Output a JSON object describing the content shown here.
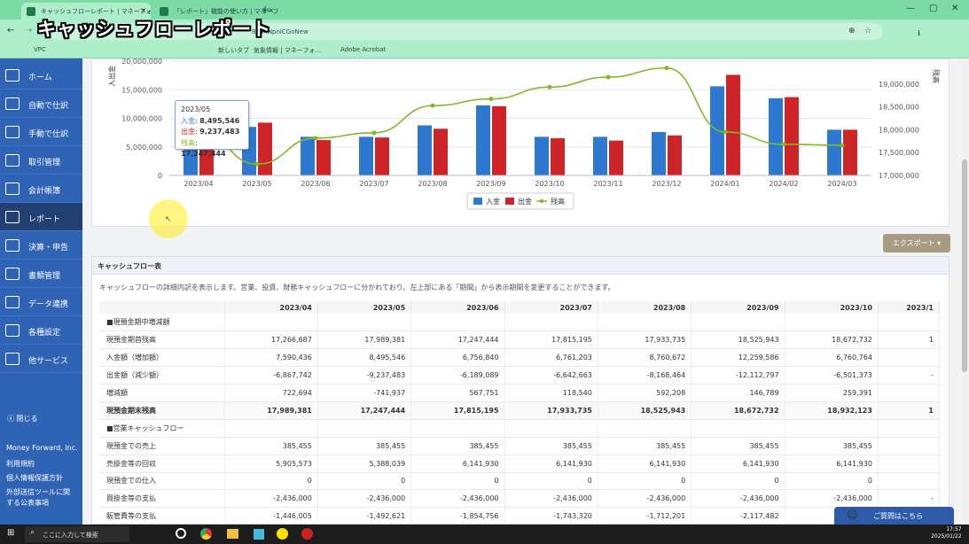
{
  "overlay_title": "キャッシュフローレポート",
  "browser": {
    "tabs": [
      {
        "label": "キャッシュフローレポート | マネーフォワ"
      },
      {
        "label": "「レポート」機能の使い方 | マネーフォ"
      }
    ],
    "url": "8644NpnlCGoNew",
    "bookmarks": [
      "VPC",
      "新しいタブ",
      "気象情報 | マネーフォ...",
      "Adobe Acrobat"
    ]
  },
  "sidebar": {
    "items": [
      {
        "label": "ホーム",
        "icon": "home-icon"
      },
      {
        "label": "自動で仕訳",
        "icon": "auto-journal-icon"
      },
      {
        "label": "手動で仕訳",
        "icon": "manual-journal-icon"
      },
      {
        "label": "取引管理",
        "icon": "transaction-icon"
      },
      {
        "label": "会計帳簿",
        "icon": "ledger-icon"
      },
      {
        "label": "レポート",
        "icon": "report-icon"
      },
      {
        "label": "決算・申告",
        "icon": "settlement-icon"
      },
      {
        "label": "書類管理",
        "icon": "folder-icon"
      },
      {
        "label": "データ連携",
        "icon": "link-icon"
      },
      {
        "label": "各種設定",
        "icon": "gear-icon"
      },
      {
        "label": "他サービス",
        "icon": "list-icon"
      }
    ],
    "close_label": "閉じる",
    "footer": [
      "Money Forward, Inc.",
      "利用規約",
      "個人情報保護方針",
      "外部送信ツールに関",
      "する公表事項"
    ]
  },
  "chart_data": {
    "type": "bar",
    "categories": [
      "2023/04",
      "2023/05",
      "2023/06",
      "2023/07",
      "2023/08",
      "2023/09",
      "2023/10",
      "2023/11",
      "2023/12",
      "2024/01",
      "2024/02",
      "2024/03"
    ],
    "series": [
      {
        "name": "入金",
        "color": "#2f78d0",
        "values": [
          7590436,
          8495546,
          6756840,
          6761203,
          8760672,
          12259586,
          6760764,
          6760764,
          7600000,
          15600000,
          13500000,
          8000000
        ]
      },
      {
        "name": "出金",
        "color": "#cc2428",
        "values": [
          8367742,
          9237483,
          6189089,
          6642663,
          8168464,
          12112797,
          6501373,
          6100000,
          7000000,
          17600000,
          13700000,
          8000000
        ]
      },
      {
        "name": "残高",
        "color": "#86b62a",
        "axis": "right",
        "values": [
          17989381,
          17247444,
          17815195,
          17933735,
          18525943,
          18672732,
          18932123,
          19150000,
          19350000,
          17950000,
          17680000,
          17660000
        ]
      }
    ],
    "ylabel": "入出金",
    "y2label": "残高",
    "ylim": [
      0,
      20000000
    ],
    "y2lim": [
      17000000,
      19500000
    ],
    "yticks": [
      "0",
      "5,000,000",
      "10,000,000",
      "15,000,000",
      "20,000,000"
    ],
    "y2ticks": [
      "17,000,000",
      "17,500,000",
      "18,000,000",
      "18,500,000",
      "19,000,000"
    ],
    "legend": [
      "入金",
      "出金",
      "残高"
    ],
    "legend_position": "bottom",
    "tooltip": {
      "title": "2023/05",
      "in_label": "入金",
      "in_value": "8,495,546",
      "out_label": "出金",
      "out_value": "9,237,483",
      "bal_label": "残高",
      "bal_value": "17,247,444"
    }
  },
  "export_label": "エクスポート ▾",
  "cashflow": {
    "title": "キャッシュフロー表",
    "description": "キャッシュフローの詳細内訳を表示します。営業、投資、財務キャッシュフローに分かれており、左上部にある「期間」から表示期間を変更することができます。",
    "headers": [
      "",
      "2023/04",
      "2023/05",
      "2023/06",
      "2023/07",
      "2023/08",
      "2023/09",
      "2023/10",
      "2023/1"
    ],
    "rows": [
      {
        "label": "■現預金期中増減額",
        "cells": [
          "",
          "",
          "",
          "",
          "",
          "",
          "",
          ""
        ]
      },
      {
        "label": "現預金期首残高",
        "cells": [
          "17,266,687",
          "17,989,381",
          "17,247,444",
          "17,815,195",
          "17,933,735",
          "18,525,943",
          "18,672,732",
          "1"
        ]
      },
      {
        "label": "入金額（増加額）",
        "cells": [
          "7,590,436",
          "8,495,546",
          "6,756,840",
          "6,761,203",
          "8,760,672",
          "12,259,586",
          "6,760,764",
          ""
        ]
      },
      {
        "label": "出金額（減少額）",
        "cells": [
          "-6,867,742",
          "-9,237,483",
          "-6,189,089",
          "-6,642,663",
          "-8,168,464",
          "-12,112,797",
          "-6,501,373",
          "-"
        ]
      },
      {
        "label": "増減額",
        "cells": [
          "722,694",
          "-741,937",
          "567,751",
          "118,540",
          "592,208",
          "146,789",
          "259,391",
          ""
        ]
      },
      {
        "label": "現預金期末残高",
        "total": true,
        "cells": [
          "17,989,381",
          "17,247,444",
          "17,815,195",
          "17,933,735",
          "18,525,943",
          "18,672,732",
          "18,932,123",
          "1"
        ]
      },
      {
        "label": "■営業キャッシュフロー",
        "cells": [
          "",
          "",
          "",
          "",
          "",
          "",
          "",
          ""
        ]
      },
      {
        "label": "現預金での売上",
        "cells": [
          "385,455",
          "385,455",
          "385,455",
          "385,455",
          "385,455",
          "385,455",
          "385,455",
          ""
        ]
      },
      {
        "label": "売掛金等の回収",
        "cells": [
          "5,905,573",
          "5,388,039",
          "6,141,930",
          "6,141,930",
          "6,141,930",
          "6,141,930",
          "6,141,930",
          ""
        ]
      },
      {
        "label": "現預金での仕入",
        "cells": [
          "0",
          "0",
          "0",
          "0",
          "0",
          "0",
          "0",
          ""
        ]
      },
      {
        "label": "買掛金等の支払",
        "cells": [
          "-2,436,000",
          "-2,436,000",
          "-2,436,000",
          "-2,436,000",
          "-2,436,000",
          "-2,436,000",
          "-2,436,000",
          "-"
        ]
      },
      {
        "label": "販管費等の支払",
        "cells": [
          "-1,446,005",
          "-1,492,621",
          "-1,854,756",
          "-1,743,320",
          "-1,712,201",
          "-2,117,482",
          "",
          ""
        ]
      }
    ]
  },
  "help_label": "ご質問はこちら",
  "taskbar": {
    "search_placeholder": "ここに入力して検索",
    "time": "17:57",
    "date": "2025/01/22"
  }
}
